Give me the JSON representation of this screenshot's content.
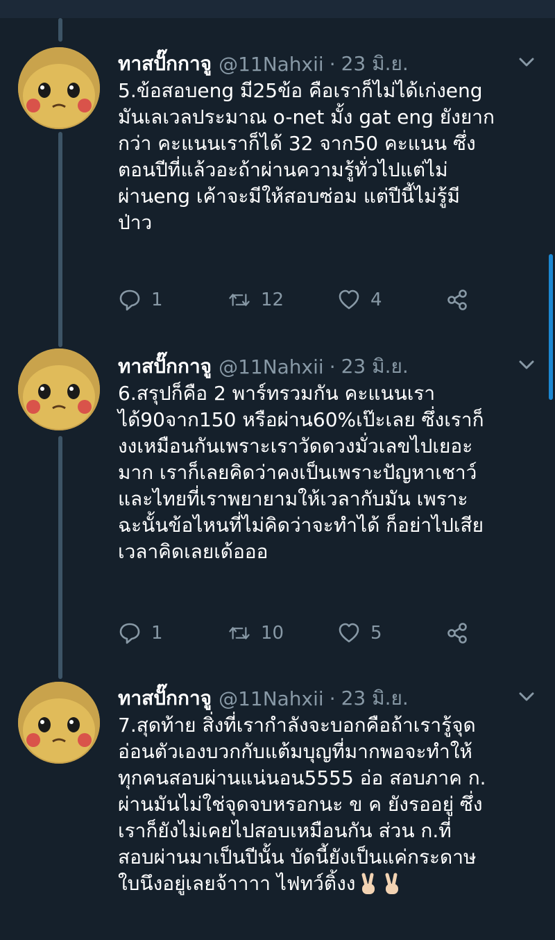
{
  "tweets": [
    {
      "name": "ทาสปั๊กกาจู",
      "handle": "@11Nahxii",
      "separator": "·",
      "date": "23 มิ.ย.",
      "lines": [
        "5.ข้อสอบeng มี25ข้อ คือเราก็ไม่ได้เก่งeng",
        "มันเลเวลประมาณ o-net มั้ง gat eng ยังยาก",
        "กว่า คะแนนเราก็ได้ 32 จาก50 คะแนน ซึ่ง",
        "ตอนปีที่แล้วอะถ้าผ่านความรู้ทั่วไปแต่ไม่",
        "ผ่านeng เค้าจะมีให้สอบซ่อม แต่ปีนี้ไม่รู้มี",
        "ป่าว"
      ],
      "replies": "1",
      "retweets": "12",
      "likes": "4"
    },
    {
      "name": "ทาสปั๊กกาจู",
      "handle": "@11Nahxii",
      "separator": "·",
      "date": "23 มิ.ย.",
      "lines": [
        "6.สรุปก็คือ 2 พาร์ทรวมกัน คะแนนเรา",
        "ได้90จาก150 หรือผ่าน60%เป๊ะเลย ซึ่งเราก็",
        "งงเหมือนกันเพราะเราวัดดวงมั่วเลขไปเยอะ",
        "มาก เราก็เลยคิดว่าคงเป็นเพราะปัญหาเชาว์",
        "และไทยที่เราพยายามให้เวลากับมัน เพราะ",
        "ฉะนั้นข้อไหนที่ไม่คิดว่าจะทำได้ ก็อย่าไปเสีย",
        "เวลาคิดเลยเด้อออ"
      ],
      "replies": "1",
      "retweets": "10",
      "likes": "5"
    },
    {
      "name": "ทาสปั๊กกาจู",
      "handle": "@11Nahxii",
      "separator": "·",
      "date": "23 มิ.ย.",
      "lines": [
        "7.สุดท้าย สิ่งที่เรากำลังจะบอกคือถ้าเรารู้จุด",
        "อ่อนตัวเองบวกกับแต้มบุญที่มากพอจะทำให้",
        "ทุกคนสอบผ่านแน่นอน5555 อ่อ สอบภาค ก.",
        "ผ่านมันไม่ใช่จุดจบหรอกนะ ข ค ยังรออยู่ ซึ่ง",
        "เราก็ยังไม่เคยไปสอบเหมือนกัน ส่วน ก.ที่",
        "สอบผ่านมาเป็นปีนั้น บัดนี้ยังเป็นแค่กระดาษ",
        "ใบนึงอยู่เลยจ้าาาา ไฟทว์ติ้งง"
      ],
      "emojis": [
        "victory-hand-emoji",
        "victory-hand-emoji"
      ]
    }
  ],
  "colors": {
    "background": "#15202b",
    "secondary_text": "#8899a6",
    "thread_line": "#3d5466",
    "scrollbar": "#1d9bf0"
  },
  "icons": [
    "reply-icon",
    "retweet-icon",
    "like-icon",
    "share-icon",
    "chevron-down-icon",
    "avatar-pikachu"
  ]
}
